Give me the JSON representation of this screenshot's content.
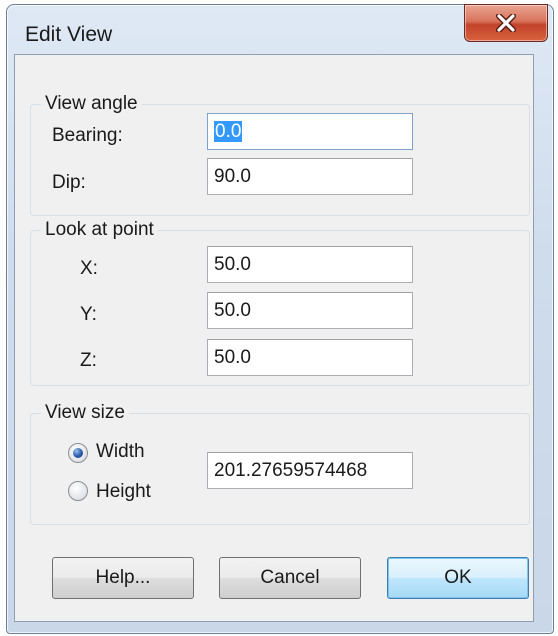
{
  "window": {
    "title": "Edit View",
    "close_glyph": "X"
  },
  "view_angle": {
    "legend": "View angle",
    "bearing_label": "Bearing:",
    "bearing_value": "0.0",
    "dip_label": "Dip:",
    "dip_value": "90.0"
  },
  "look_at_point": {
    "legend": "Look at point",
    "x_label": "X:",
    "x_value": "50.0",
    "y_label": "Y:",
    "y_value": "50.0",
    "z_label": "Z:",
    "z_value": "50.0"
  },
  "view_size": {
    "legend": "View size",
    "width_label": "Width",
    "height_label": "Height",
    "selected": "Width",
    "size_value": "201.27659574468"
  },
  "buttons": {
    "help": "Help...",
    "cancel": "Cancel",
    "ok": "OK"
  },
  "colors": {
    "selection": "#3399ff",
    "close_button": "#c2432a",
    "default_button_border": "#3c7fb1"
  },
  "icons": {
    "close": "close-icon"
  }
}
